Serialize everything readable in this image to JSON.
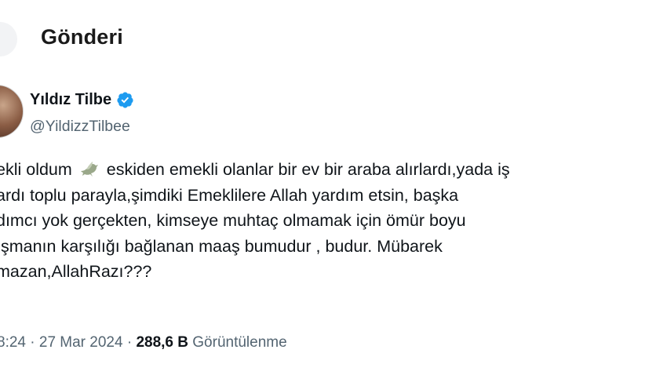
{
  "header": {
    "title": "Gönderi"
  },
  "author": {
    "display_name": "Yıldız Tilbe",
    "handle": "@YildizzTilbee"
  },
  "tweet": {
    "lines": [
      {
        "before": "ekli oldum",
        "icon": "dove-icon",
        "after": "eskiden emekli olanlar bir ev bir araba alırlardı,yada iş"
      },
      {
        "text": "ardı toplu parayla,şimdiki Emeklilere Allah yardım etsin, başka"
      },
      {
        "text": "dımcı yok gerçekten, kimseye muhtaç olmamak için ömür boyu"
      },
      {
        "text": "ışmanın karşılığı bağlanan maaş bumudur , budur. Mübarek"
      },
      {
        "text": "mazan,AllahRazı???"
      }
    ]
  },
  "meta": {
    "time": "8:24",
    "separator": "·",
    "date": "27 Mar 2024",
    "views_count": "288,6 B",
    "views_label": "Görüntülenme"
  },
  "colors": {
    "verified": "#1d9bf0",
    "secondary_text": "#536471",
    "dove": "#9aa88a"
  }
}
